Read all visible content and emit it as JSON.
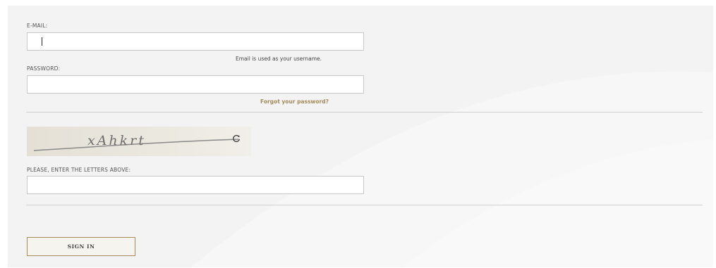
{
  "form": {
    "email_label": "E-MAIL:",
    "email_value": "",
    "email_hint": "Email is used as your username.",
    "password_label": "PASSWORD:",
    "password_value": "",
    "forgot_link": "Forgot your password?",
    "captcha_text": "xAhkrt",
    "captcha_label": "PLEASE, ENTER THE LETTERS ABOVE:",
    "captcha_value": "",
    "signin_label": "SIGN IN"
  },
  "colors": {
    "panel_bg": "#f3f3f3",
    "accent_gold": "#a48b5a",
    "divider": "#cfcfcf"
  },
  "icons": {
    "refresh": "refresh-icon"
  }
}
